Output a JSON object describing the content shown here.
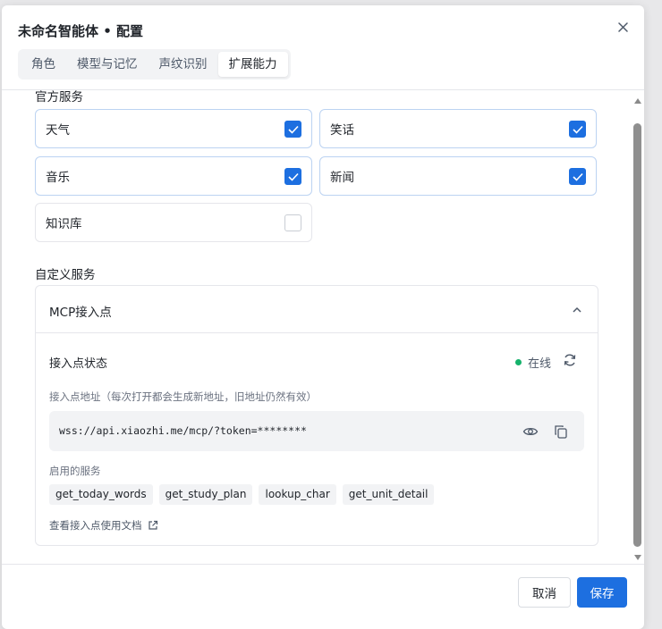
{
  "dialog": {
    "title": "未命名智能体 • 配置",
    "tabs": [
      {
        "label": "角色"
      },
      {
        "label": "模型与记忆"
      },
      {
        "label": "声纹识别"
      },
      {
        "label": "扩展能力"
      }
    ],
    "active_tab": "扩展能力"
  },
  "official_services": {
    "title": "官方服务",
    "items": [
      {
        "label": "天气",
        "checked": true
      },
      {
        "label": "笑话",
        "checked": true
      },
      {
        "label": "音乐",
        "checked": true
      },
      {
        "label": "新闻",
        "checked": true
      },
      {
        "label": "知识库",
        "checked": false
      }
    ]
  },
  "custom_services": {
    "title": "自定义服务",
    "mcp": {
      "title": "MCP接入点",
      "status_label": "接入点状态",
      "status_value": "在线",
      "address_label": "接入点地址（每次打开都会生成新地址，旧地址仍然有效）",
      "address_value": "wss://api.xiaozhi.me/mcp/?token=********",
      "enabled_label": "启用的服务",
      "enabled_services": [
        "get_today_words",
        "get_study_plan",
        "lookup_char",
        "get_unit_detail"
      ],
      "doc_link": "查看接入点使用文档"
    }
  },
  "footer": {
    "cancel_label": "取消",
    "save_label": "保存"
  },
  "colors": {
    "primary": "#1d6fe0",
    "online": "#15b26b"
  }
}
